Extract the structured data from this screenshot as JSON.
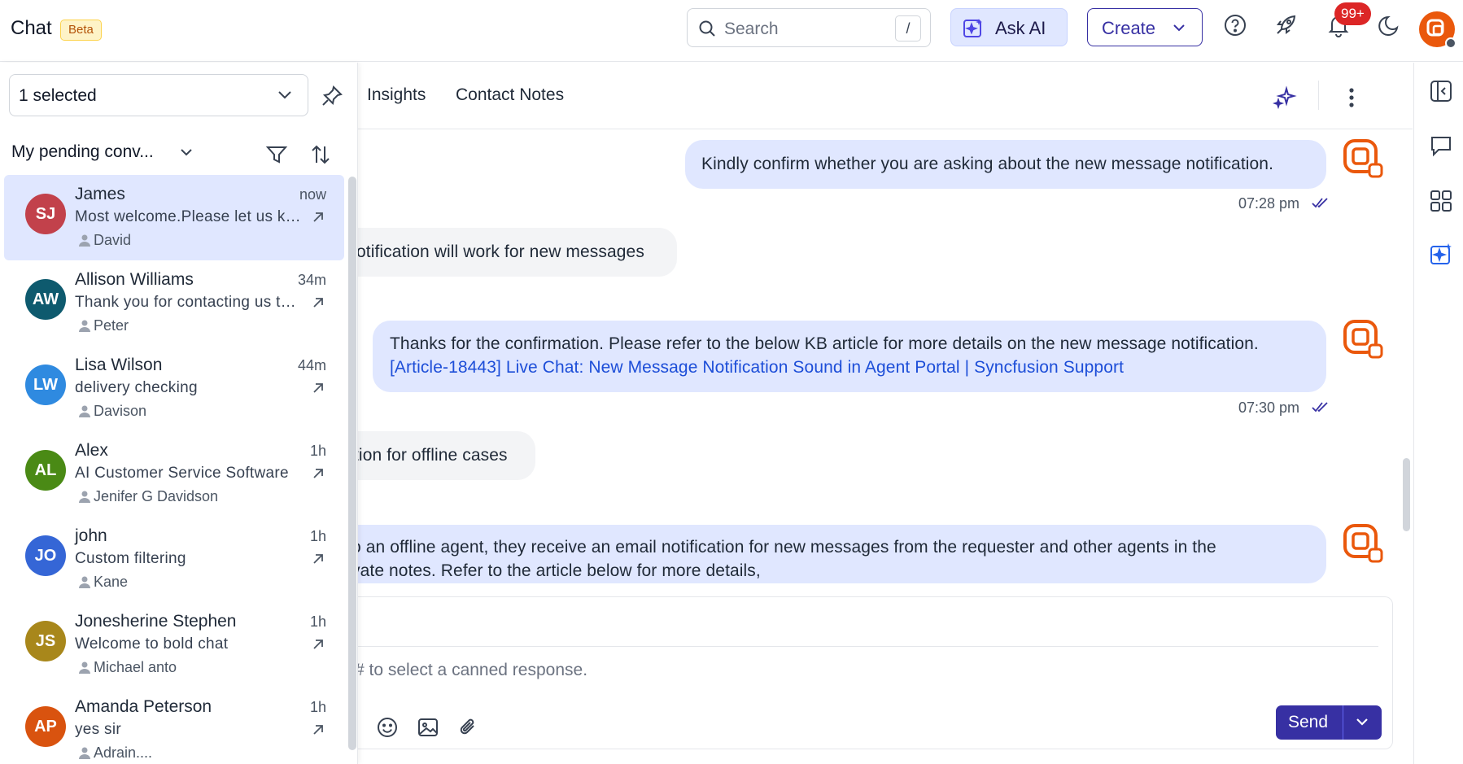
{
  "header": {
    "app_title": "Chat",
    "beta_label": "Beta",
    "search_placeholder": "Search",
    "search_shortcut": "/",
    "ask_ai_label": "Ask AI",
    "create_label": "Create",
    "notification_count": "99+",
    "icons": [
      "help-icon",
      "rocket-icon",
      "bell-icon",
      "moon-icon"
    ]
  },
  "sidebar": {
    "selected_label": "1 selected",
    "filter_title": "My pending conv...",
    "conversations": [
      {
        "initials": "SJ",
        "name": "James",
        "time": "now",
        "preview": "Most welcome.Please let us know if you need anything else",
        "agent": "David",
        "color": "#c2414b",
        "active": true
      },
      {
        "initials": "AW",
        "name": "Allison Williams",
        "time": "34m",
        "preview": "Thank you for contacting us today",
        "agent": "Peter",
        "color": "#0e5a6e",
        "active": false
      },
      {
        "initials": "LW",
        "name": "Lisa Wilson",
        "time": "44m",
        "preview": "delivery checking",
        "agent": "Davison",
        "color": "#2f8ae0",
        "active": false
      },
      {
        "initials": "AL",
        "name": "Alex",
        "time": "1h",
        "preview": "AI Customer Service Software",
        "agent": "Jenifer G Davidson",
        "color": "#4a8a15",
        "active": false
      },
      {
        "initials": "JO",
        "name": "john",
        "time": "1h",
        "preview": "Custom filtering",
        "agent": "Kane",
        "color": "#3566d6",
        "active": false
      },
      {
        "initials": "JS",
        "name": "Jonesherine Stephen",
        "time": "1h",
        "preview": "Welcome to bold chat",
        "agent": "Michael anto",
        "color": "#a8871b",
        "active": false
      },
      {
        "initials": "AP",
        "name": "Amanda Peterson",
        "time": "1h",
        "preview": "yes sir",
        "agent": "Adrain....",
        "color": "#d9530f",
        "active": false
      }
    ]
  },
  "tabs": {
    "insights": "Insights",
    "contact_notes": "Contact Notes"
  },
  "messages": {
    "m1": "Kindly confirm whether you are asking about the new message notification.",
    "m1_time": "07:28 pm",
    "m2": "otification will work for new messages",
    "m3_text": "Thanks for the confirmation. Please refer to the below KB article for more details on the new message notification.",
    "m3_link": "[Article-18443] Live Chat: New Message Notification Sound in Agent Portal | Syncfusion Support",
    "m3_time": "07:30 pm",
    "m4": "tion for offline cases",
    "m5_line1": "o an offline agent, they receive an email notification for new messages from the requester and other agents in the",
    "m5_line2": "vate notes. Refer to the article below for more details,"
  },
  "composer": {
    "placeholder": "# to select a canned response.",
    "send_label": "Send"
  },
  "colors": {
    "accent": "#3730a3",
    "outgoing_bubble": "#e0e7ff",
    "incoming_bubble": "#f3f4f6",
    "link": "#1d4ed8",
    "notification_badge": "#dc2626"
  }
}
